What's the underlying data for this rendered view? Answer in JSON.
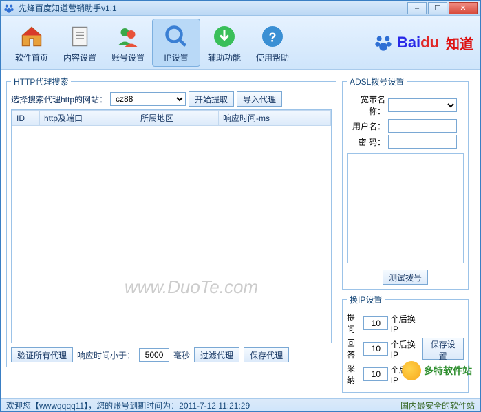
{
  "window": {
    "title": "先烽百度知道营销助手v1.1"
  },
  "toolbar": {
    "items": [
      {
        "label": "软件首页"
      },
      {
        "label": "内容设置"
      },
      {
        "label": "账号设置"
      },
      {
        "label": "IP设置"
      },
      {
        "label": "辅助功能"
      },
      {
        "label": "使用帮助"
      }
    ]
  },
  "brand": {
    "bai": "Bai",
    "du": "du",
    "zhidao": "知道"
  },
  "http_proxy": {
    "legend": "HTTP代理搜索",
    "site_label": "选择搜索代理http的网站：",
    "site_value": "cz88",
    "start_btn": "开始提取",
    "import_btn": "导入代理",
    "columns": [
      "ID",
      "http及端口",
      "所属地区",
      "响应时间-ms"
    ],
    "verify_btn": "验证所有代理",
    "filter_label_pre": "响应时间小于：",
    "filter_value": "5000",
    "filter_unit": "毫秒",
    "filter_btn": "过滤代理",
    "save_btn": "保存代理"
  },
  "adsl": {
    "legend": "ADSL拨号设置",
    "bandwidth_label": "宽带名称：",
    "user_label": "用户名：",
    "pass_label": "密  码：",
    "test_btn": "测试拨号"
  },
  "ip_change": {
    "legend": "换IP设置",
    "q_label": "提问",
    "q_value": "10",
    "q_suffix": "个后换IP",
    "a_label": "回答",
    "a_value": "10",
    "a_suffix": "个后换IP",
    "c_label": "采纳",
    "c_value": "10",
    "c_suffix": "个后换IP",
    "save_btn": "保存设置"
  },
  "status": {
    "left": "欢迎您【wwwqqqq11】，您的账号到期时间为：2011-7-12 11:21:29",
    "right": "国内最安全的软件站"
  },
  "watermark": "www.DuoTe.com",
  "duote": "多特软件站"
}
